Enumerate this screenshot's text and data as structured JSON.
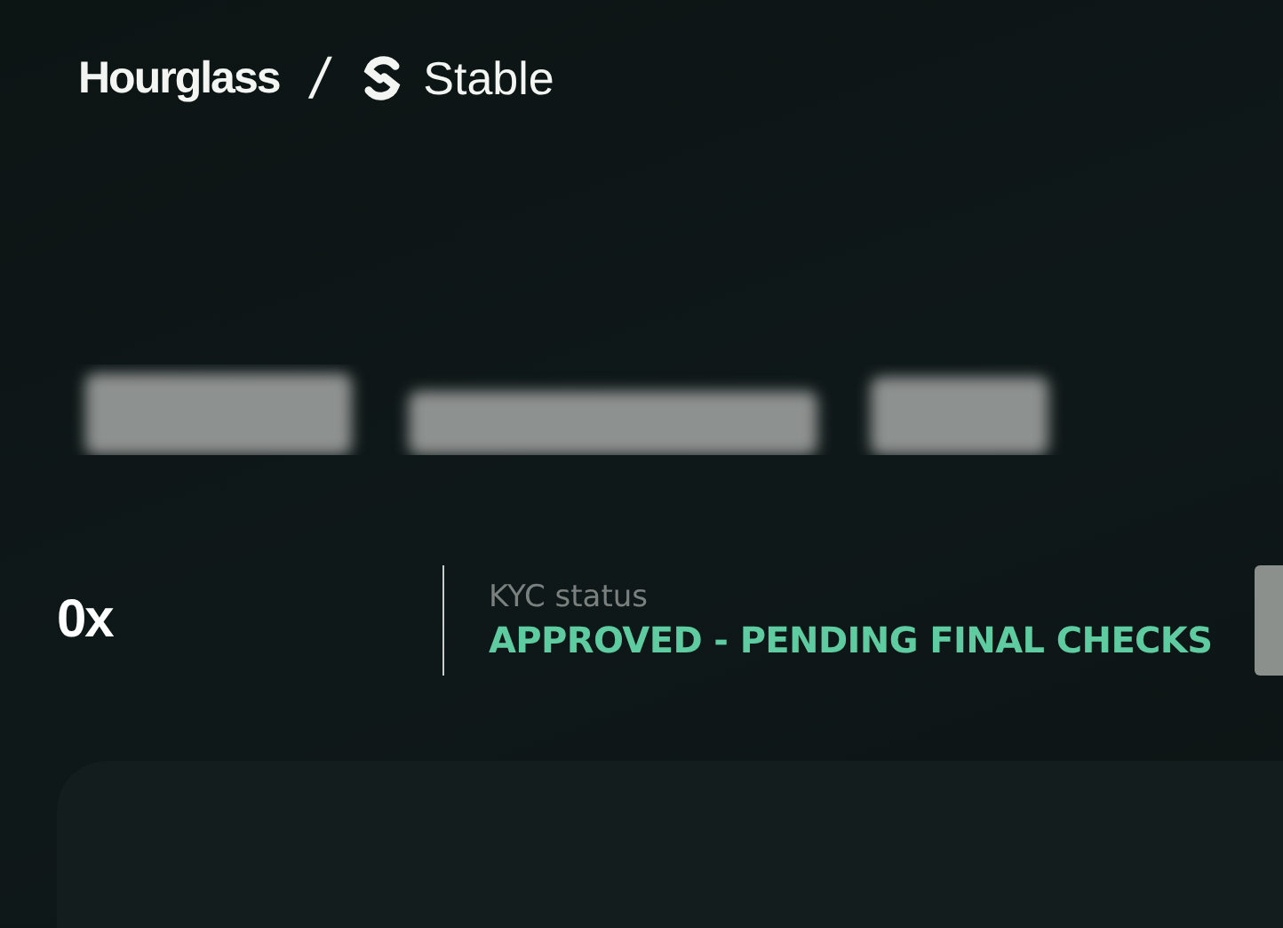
{
  "header": {
    "brand": "Hourglass",
    "separator": "/",
    "partner": "Stable"
  },
  "wallet": {
    "address": "0x"
  },
  "kyc": {
    "label": "KYC status",
    "status": "APPROVED - PENDING FINAL CHECKS"
  }
}
